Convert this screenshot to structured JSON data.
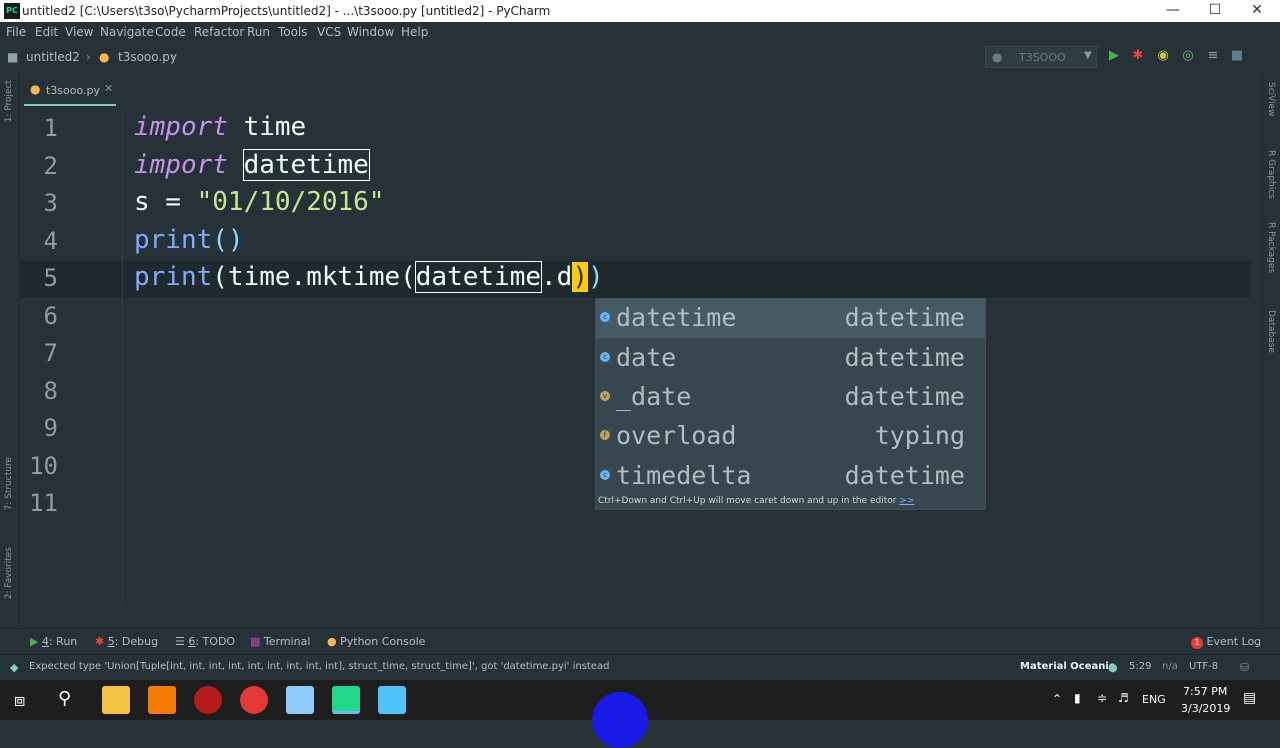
{
  "window": {
    "title": "untitled2 [C:\\Users\\t3so\\PycharmProjects\\untitled2] - ...\\t3sooo.py [untitled2] - PyCharm",
    "app_icon_text": "PC"
  },
  "menu": [
    "File",
    "Edit",
    "View",
    "Navigate",
    "Code",
    "Refactor",
    "Run",
    "Tools",
    "VCS",
    "Window",
    "Help"
  ],
  "breadcrumb": {
    "project": "untitled2",
    "file": "t3sooo.py"
  },
  "run_config": {
    "label": "T3SOOO"
  },
  "tab": {
    "label": "t3sooo.py"
  },
  "side_tools": {
    "left": [
      "1: Project",
      "7: Structure",
      "2: Favorites"
    ],
    "right": [
      "SciView",
      "R Graphics",
      "R Packages",
      "Database"
    ]
  },
  "editor": {
    "line_numbers": [
      "1",
      "2",
      "3",
      "4",
      "5",
      "6",
      "7",
      "8",
      "9",
      "10",
      "11"
    ],
    "lines": {
      "l1_kw": "import",
      "l1_rest": " time",
      "l2_kw": "import",
      "l2_sp": " ",
      "l2_mod": "datetime",
      "l3_a": "s = ",
      "l3_str": "\"01/10/2016\"",
      "l4_fn": "print",
      "l4_paren": "()",
      "l5_fn": "print",
      "l5_p1": "(time.mktime(",
      "l5_mod": "datetime",
      "l5_dot": ".d",
      "l5_caret": ")",
      "l5_end": ")"
    }
  },
  "completion": {
    "items": [
      {
        "name": "datetime",
        "type": "datetime",
        "kind": "c"
      },
      {
        "name": "date",
        "type": "datetime",
        "kind": "c"
      },
      {
        "name": "_date",
        "type": "datetime",
        "kind": "v"
      },
      {
        "name": "overload",
        "type": "typing",
        "kind": "f"
      },
      {
        "name": "timedelta",
        "type": "datetime",
        "kind": "c"
      }
    ],
    "hint": "Ctrl+Down and Ctrl+Up will move caret down and up in the editor",
    "hint_link": ">>"
  },
  "bottom_tools": [
    {
      "num": "4",
      "label": ": Run"
    },
    {
      "num": "5",
      "label": ": Debug"
    },
    {
      "num": "6",
      "label": ": TODO"
    },
    {
      "num": "",
      "label": "Terminal"
    },
    {
      "num": "",
      "label": "Python Console"
    }
  ],
  "event_log": {
    "badge": "1",
    "label": "Event Log"
  },
  "status": {
    "message": "Expected type 'Union[Tuple[int, int, int, int, int, int, int, int, int], struct_time, struct_time]', got 'datetime.pyi' instead",
    "theme": "Material Oceanic",
    "position": "5:29",
    "na": "n/a",
    "encoding": "UTF-8"
  },
  "taskbar": {
    "lang": "ENG",
    "time": "7:57 PM",
    "date": "3/3/2019"
  },
  "colors": {
    "background": "#263238",
    "keyword": "#c792ea",
    "string": "#c3e88d",
    "caret": "#ffcc00"
  }
}
